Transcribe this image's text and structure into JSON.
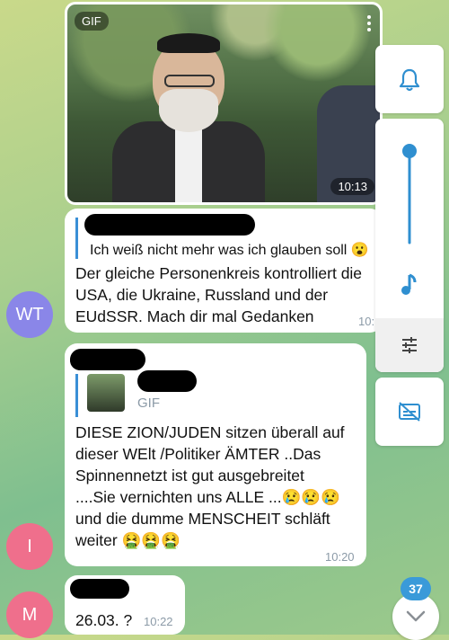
{
  "gif_message": {
    "badge": "GIF",
    "time": "10:13"
  },
  "message_1": {
    "reply_text": "Ich weiß nicht mehr was ich glauben soll",
    "reply_emoji": "😮",
    "text": "Der gleiche Personenkreis kontrolliert die USA, die Ukraine, Russland und der EUdSSR. Mach dir mal Gedanken",
    "time": "10:"
  },
  "message_2": {
    "reply_label": "GIF",
    "text": "DIESE ZION/JUDEN sitzen überall auf dieser WElt /Politiker ÄMTER   ..Das Spinnennetzt  ist gut  ausgebreitet ....Sie  vernichten uns ALLE ...😢😢😢und die dumme MENSCHEIT schläft weiter  🤮🤮🤮",
    "time": "10:20"
  },
  "message_3": {
    "text": "26.03. ?",
    "time": "10:22"
  },
  "avatars": {
    "wt": "WT",
    "i": "I",
    "m": "M"
  },
  "controls": {
    "unread_count": "37",
    "accent_color": "#2f8fd0",
    "icons": [
      "bell-icon",
      "volume-slider",
      "music-note-icon",
      "tune-icon",
      "subtitles-off-icon",
      "chevron-down-icon"
    ]
  }
}
